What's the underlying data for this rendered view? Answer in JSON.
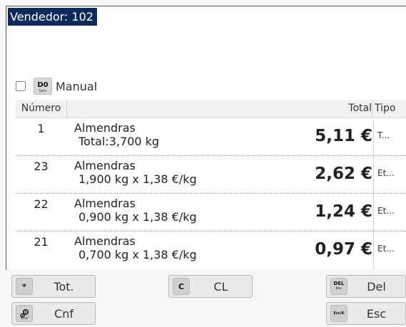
{
  "header": {
    "vendor_label": "Vendedor: 102"
  },
  "manual": {
    "key_main": "D0",
    "key_sub": "Sers",
    "label": "Manual"
  },
  "table": {
    "columns": [
      "Número",
      "Total",
      "Tipo"
    ],
    "rows": [
      {
        "number": "1",
        "name": "Almendras",
        "detail": "Total:3,700 kg",
        "total": "5,11 €",
        "type": "T..."
      },
      {
        "number": "23",
        "name": "Almendras",
        "detail": "1,900 kg x 1,38 €/kg",
        "total": "2,62 €",
        "type": "Et..."
      },
      {
        "number": "22",
        "name": "Almendras",
        "detail": "0,900 kg x 1,38 €/kg",
        "total": "1,24 €",
        "type": "Et..."
      },
      {
        "number": "21",
        "name": "Almendras",
        "detail": "0,700 kg x 1,38 €/kg",
        "total": "0,97 €",
        "type": "Et..."
      }
    ]
  },
  "buttons": {
    "tot": {
      "key": "*",
      "label": "Tot."
    },
    "cl": {
      "key": "C",
      "label": "CL"
    },
    "del": {
      "key": "DEL",
      "key_sub": "Ins.",
      "label": "Del"
    },
    "cnf": {
      "key_icon": "gears-icon",
      "key_sub": "End",
      "label": "Cnf"
    },
    "esc": {
      "key": "Esc/K",
      "label": "Esc"
    }
  }
}
